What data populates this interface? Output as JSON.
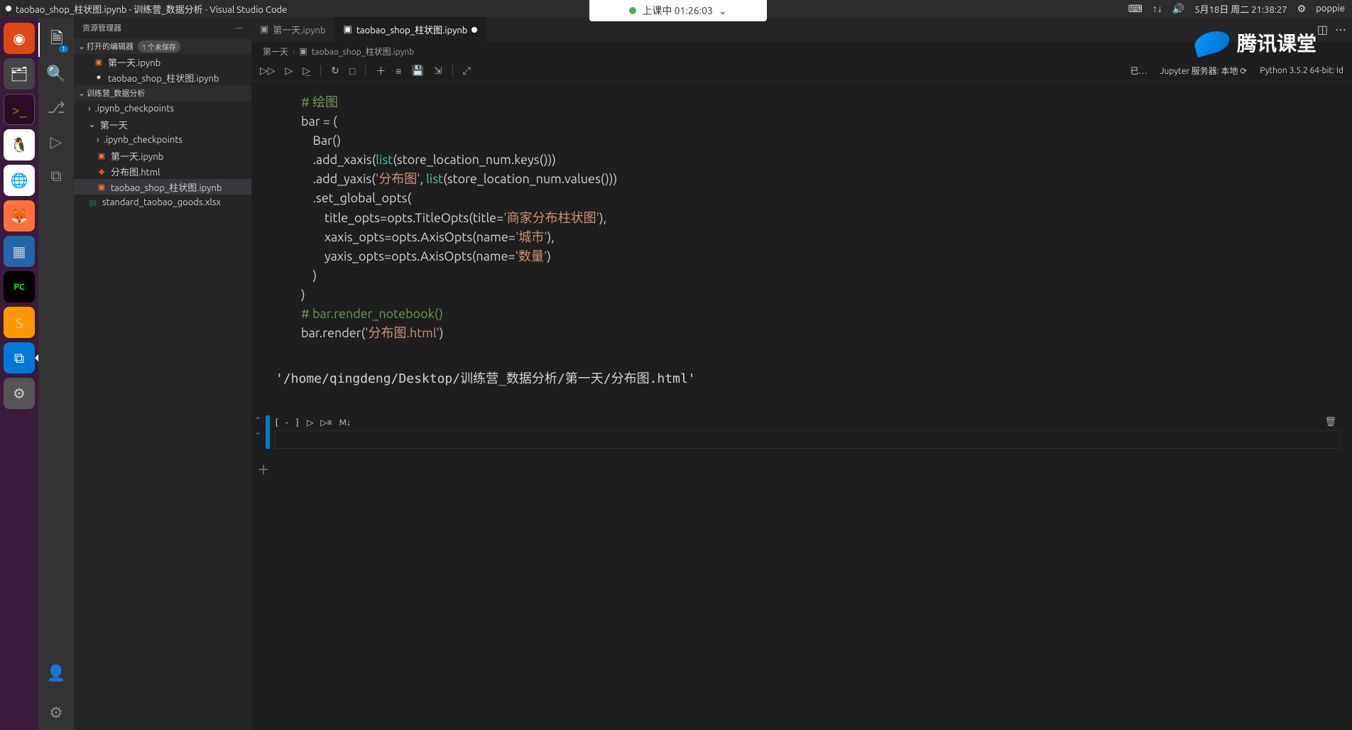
{
  "menubar": {
    "title": "taobao_shop_柱状图.ipynb - 训练营_数据分析 - Visual Studio Code",
    "date": "5月18日 周二 21:38:27",
    "user": "poppie"
  },
  "class_pill": {
    "label": "上课中 01:26:03"
  },
  "tencent_logo": "腾讯课堂",
  "activitybar": {
    "explorer_badge": "1"
  },
  "sidebar": {
    "title": "资源管理器",
    "open_editors": {
      "label": "打开的编辑器",
      "unsaved": "1 个未保存",
      "items": [
        {
          "name": "第一天.ipynb",
          "modified": false
        },
        {
          "name": "taobao_shop_柱状图.ipynb",
          "modified": true
        }
      ]
    },
    "folder": {
      "name": "训练营_数据分析",
      "children": [
        {
          "type": "folder",
          "name": ".ipynb_checkpoints",
          "depth": 1,
          "expanded": false
        },
        {
          "type": "folder",
          "name": "第一天",
          "depth": 1,
          "expanded": true
        },
        {
          "type": "folder",
          "name": ".ipynb_checkpoints",
          "depth": 2,
          "expanded": false
        },
        {
          "type": "file",
          "name": "第一天.ipynb",
          "icon": "ipynb",
          "depth": 2
        },
        {
          "type": "file",
          "name": "分布图.html",
          "icon": "html",
          "depth": 2
        },
        {
          "type": "file",
          "name": "taobao_shop_柱状图.ipynb",
          "icon": "ipynb",
          "depth": 2,
          "active": true
        },
        {
          "type": "file",
          "name": "standard_taobao_goods.xlsx",
          "icon": "xlsx",
          "depth": 1
        }
      ]
    }
  },
  "tabs": [
    {
      "name": "第一天.ipynb",
      "icon": "ipynb",
      "active": false,
      "modified": false
    },
    {
      "name": "taobao_shop_柱状图.ipynb",
      "icon": "ipynb",
      "active": true,
      "modified": true
    }
  ],
  "breadcrumb": [
    "第一天",
    "taobao_shop_柱状图.ipynb"
  ],
  "nbstatus": {
    "trusted": "已…",
    "server": "Jupyter 服务器: 本地",
    "kernel": "Python 3.5.2 64-bit: Id"
  },
  "code_cell": {
    "lines": [
      {
        "t": "comment",
        "text": "# 绘图"
      },
      {
        "t": "plain",
        "text": "bar = ("
      },
      {
        "t": "plain",
        "text": "    Bar()"
      },
      {
        "t": "mixed",
        "parts": [
          {
            "c": "default",
            "v": "    .add_xaxis("
          },
          {
            "c": "builtin",
            "v": "list"
          },
          {
            "c": "default",
            "v": "(store_location_num.keys()))"
          }
        ]
      },
      {
        "t": "mixed",
        "parts": [
          {
            "c": "default",
            "v": "    .add_yaxis("
          },
          {
            "c": "str",
            "v": "'分布图'"
          },
          {
            "c": "default",
            "v": ", "
          },
          {
            "c": "builtin",
            "v": "list"
          },
          {
            "c": "default",
            "v": "(store_location_num.values()))"
          }
        ]
      },
      {
        "t": "plain",
        "text": "    .set_global_opts("
      },
      {
        "t": "mixed",
        "parts": [
          {
            "c": "default",
            "v": "        title_opts=opts.TitleOpts(title="
          },
          {
            "c": "str",
            "v": "'商家分布柱状图'"
          },
          {
            "c": "default",
            "v": "),"
          }
        ]
      },
      {
        "t": "mixed",
        "parts": [
          {
            "c": "default",
            "v": "        xaxis_opts=opts.AxisOpts(name="
          },
          {
            "c": "str",
            "v": "'城市'"
          },
          {
            "c": "default",
            "v": "),"
          }
        ]
      },
      {
        "t": "mixed",
        "parts": [
          {
            "c": "default",
            "v": "        yaxis_opts=opts.AxisOpts(name="
          },
          {
            "c": "str",
            "v": "'数量'"
          },
          {
            "c": "default",
            "v": ")"
          }
        ]
      },
      {
        "t": "plain",
        "text": "    )"
      },
      {
        "t": "plain",
        "text": ")"
      },
      {
        "t": "comment",
        "text": "# bar.render_notebook()"
      },
      {
        "t": "mixed",
        "parts": [
          {
            "c": "default",
            "v": "bar.render("
          },
          {
            "c": "str",
            "v": "'分布图.html'"
          },
          {
            "c": "default",
            "v": ")"
          }
        ]
      }
    ]
  },
  "output_text": "'/home/qingdeng/Desktop/训练营_数据分析/第一天/分布图.html'",
  "empty_cell": {
    "prompt": "[ - ]",
    "md_label": "M↓"
  }
}
